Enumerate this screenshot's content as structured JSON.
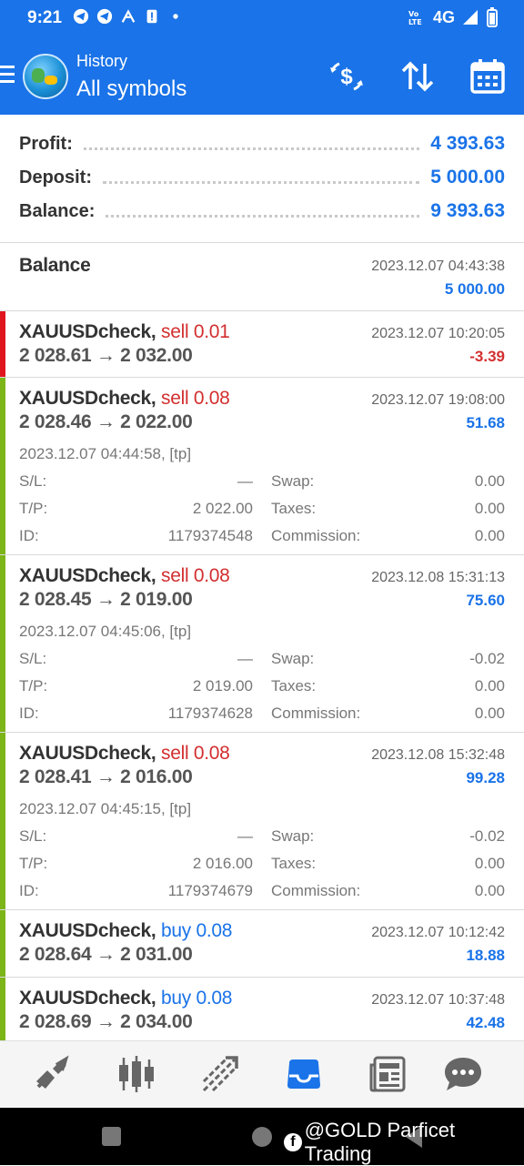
{
  "status_bar": {
    "time": "9:21",
    "network": "4G"
  },
  "header": {
    "subtitle": "History",
    "title": "All symbols"
  },
  "summary": {
    "profit_label": "Profit:",
    "profit_value": "4 393.63",
    "deposit_label": "Deposit:",
    "deposit_value": "5 000.00",
    "balance_label": "Balance:",
    "balance_value": "9 393.63"
  },
  "balance_entry": {
    "label": "Balance",
    "datetime": "2023.12.07 04:43:38",
    "amount": "5 000.00"
  },
  "detail_labels": {
    "sl": "S/L:",
    "tp": "T/P:",
    "id": "ID:",
    "swap": "Swap:",
    "taxes": "Taxes:",
    "commission": "Commission:"
  },
  "deals": [
    {
      "symbol": "XAUUSDcheck,",
      "side": "sell 0.01",
      "prices": "2 028.61 → 2 032.00",
      "close_time": "2023.12.07 10:20:05",
      "profit": "-3.39"
    },
    {
      "symbol": "XAUUSDcheck,",
      "side": "sell 0.08",
      "prices": "2 028.46 → 2 022.00",
      "close_time": "2023.12.07 19:08:00",
      "profit": "51.68",
      "open_info": "2023.12.07 04:44:58, [tp]",
      "sl": "—",
      "tp": "2 022.00",
      "id": "1179374548",
      "swap": "0.00",
      "taxes": "0.00",
      "commission": "0.00"
    },
    {
      "symbol": "XAUUSDcheck,",
      "side": "sell 0.08",
      "prices": "2 028.45 → 2 019.00",
      "close_time": "2023.12.08 15:31:13",
      "profit": "75.60",
      "open_info": "2023.12.07 04:45:06, [tp]",
      "sl": "—",
      "tp": "2 019.00",
      "id": "1179374628",
      "swap": "-0.02",
      "taxes": "0.00",
      "commission": "0.00"
    },
    {
      "symbol": "XAUUSDcheck,",
      "side": "sell 0.08",
      "prices": "2 028.41 → 2 016.00",
      "close_time": "2023.12.08 15:32:48",
      "profit": "99.28",
      "open_info": "2023.12.07 04:45:15, [tp]",
      "sl": "—",
      "tp": "2 016.00",
      "id": "1179374679",
      "swap": "-0.02",
      "taxes": "0.00",
      "commission": "0.00"
    },
    {
      "symbol": "XAUUSDcheck,",
      "side": "buy 0.08",
      "prices": "2 028.64 → 2 031.00",
      "close_time": "2023.12.07 10:12:42",
      "profit": "18.88"
    },
    {
      "symbol": "XAUUSDcheck,",
      "side": "buy 0.08",
      "prices": "2 028.69 → 2 034.00",
      "close_time": "2023.12.07 10:37:48",
      "profit": "42.48"
    }
  ],
  "colors": {
    "accent": "#1a73e8",
    "loss": "#d32f2f",
    "profit_bar": "#7cb518",
    "loss_bar": "#e0161f"
  },
  "watermark": "@GOLD Parficet Trading"
}
